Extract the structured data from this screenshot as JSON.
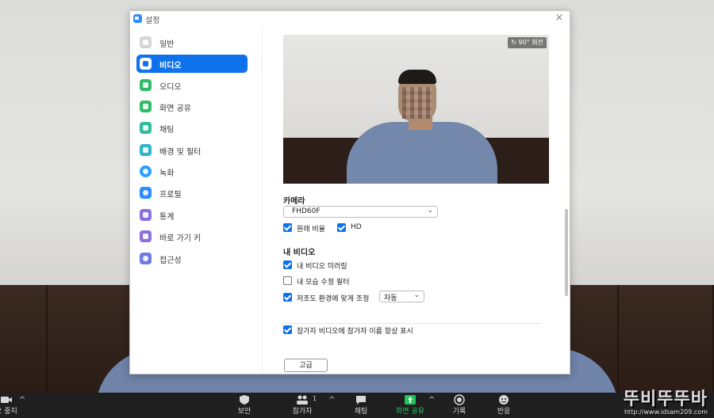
{
  "window": {
    "title": "설정",
    "close_label": "×"
  },
  "sidebar": {
    "items": [
      {
        "label": "일반",
        "icon": "gear-icon",
        "color": "#d5d5d5"
      },
      {
        "label": "비디오",
        "icon": "video-icon",
        "color": "#0e72ed",
        "active": true
      },
      {
        "label": "오디오",
        "icon": "headphones-icon",
        "color": "#2fbd6a"
      },
      {
        "label": "화면 공유",
        "icon": "share-screen-icon",
        "color": "#2fbd6a"
      },
      {
        "label": "채팅",
        "icon": "chat-icon",
        "color": "#2fbd9a"
      },
      {
        "label": "배경 및 필터",
        "icon": "background-icon",
        "color": "#2fb5c9"
      },
      {
        "label": "녹화",
        "icon": "record-icon",
        "color": "#2d9cff"
      },
      {
        "label": "프로필",
        "icon": "profile-icon",
        "color": "#2d8cff"
      },
      {
        "label": "통계",
        "icon": "statistics-icon",
        "color": "#8a6fdc"
      },
      {
        "label": "바로 가기 키",
        "icon": "keyboard-icon",
        "color": "#8a6fdc"
      },
      {
        "label": "접근성",
        "icon": "accessibility-icon",
        "color": "#6e7be0"
      }
    ]
  },
  "video": {
    "rotate_label": "↻ 90° 회전",
    "camera_title": "카메라",
    "camera_value": "FHD60F",
    "original_ratio_label": "원래 비율",
    "hd_label": "HD",
    "my_video_title": "내 비디오",
    "mirror_label": "내 비디오 미러링",
    "touch_up_label": "내 모습 수정 필터",
    "low_light_label": "저조도 환경에 맞게 조정",
    "low_light_value": "자동",
    "show_names_label": "참가자 비디오에 참가자 이름 항상 표시",
    "advanced_label": "고급"
  },
  "toolbar": {
    "stop_video": "오 중지",
    "security": "보안",
    "participants": "참가자",
    "participants_count": "1",
    "chat": "채팅",
    "share_screen": "화면 공유",
    "record": "기록",
    "reactions": "반응"
  },
  "watermark": {
    "brand": "뚜비뚜뚜바",
    "url": "http://www.idsam209.com"
  },
  "colors": {
    "accent": "#0e72ed",
    "share_green": "#22c25e"
  }
}
